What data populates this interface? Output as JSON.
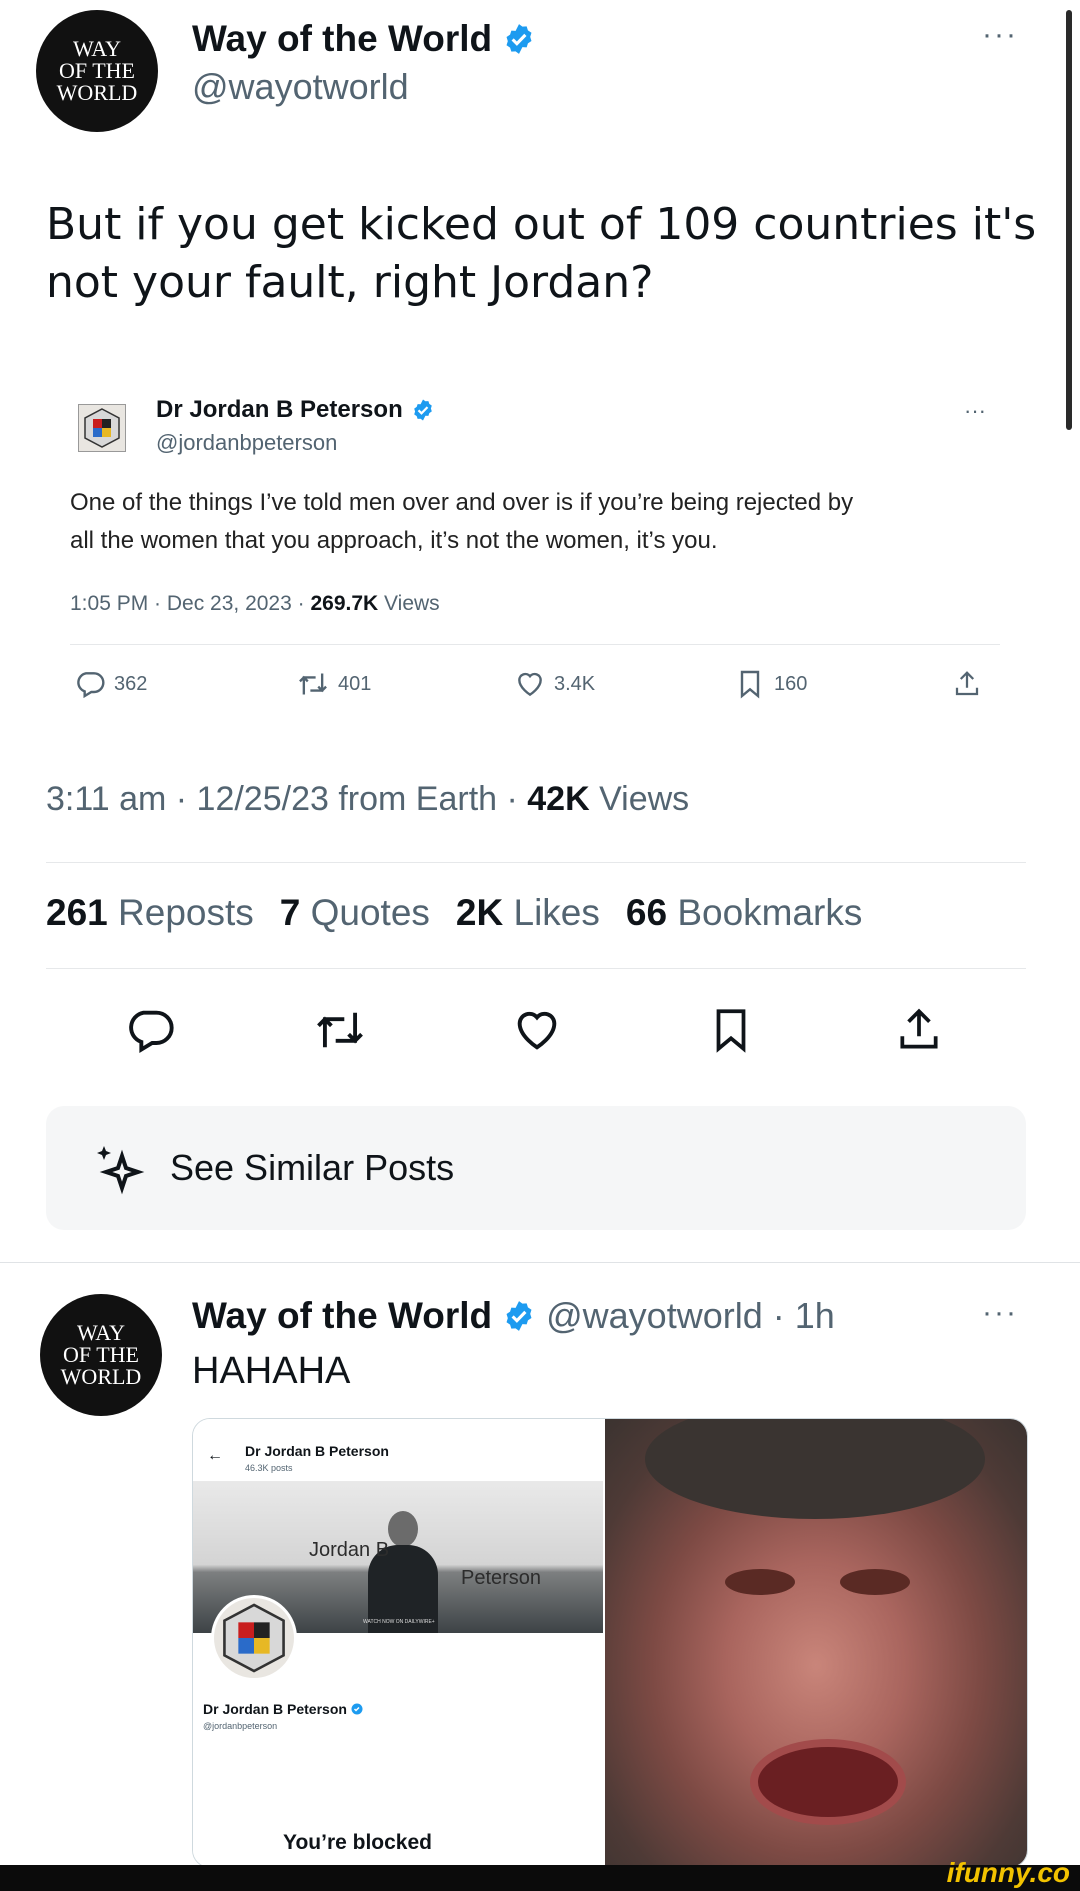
{
  "main_tweet": {
    "avatar_lines": [
      "WAY",
      "OF THE",
      "WORLD"
    ],
    "display_name": "Way of the World",
    "handle": "@wayotworld",
    "more": "···",
    "text_line1": "But if you get kicked out of 109 countries it's",
    "text_line2": "not your fault, right Jordan?",
    "meta_time": "3:11 am · 12/25/23 from Earth · ",
    "meta_views_num": "42K",
    "meta_views_label": " Views",
    "stats": [
      {
        "num": "261",
        "label": "Reposts"
      },
      {
        "num": "7",
        "label": "Quotes"
      },
      {
        "num": "2K",
        "label": "Likes"
      },
      {
        "num": "66",
        "label": "Bookmarks"
      }
    ],
    "similar_label": "See Similar Posts"
  },
  "quoted_tweet": {
    "display_name": "Dr Jordan B Peterson",
    "handle": "@jordanbpeterson",
    "more": "···",
    "text_line1": "One of the things I’ve told men over and over is if you’re being rejected by",
    "text_line2": "all the women that you approach, it’s not the women, it’s you.",
    "meta_time": "1:05 PM · Dec 23, 2023 · ",
    "meta_views_num": "269.7K",
    "meta_views_label": " Views",
    "actions": {
      "replies": "362",
      "reposts": "401",
      "likes": "3.4K",
      "bookmarks": "160"
    }
  },
  "second_tweet": {
    "avatar_lines": [
      "WAY",
      "OF THE",
      "WORLD"
    ],
    "display_name": "Way of the World",
    "handle": "@wayotworld",
    "time": "· 1h",
    "more": "···",
    "text": "HAHAHA",
    "embedded_profile": {
      "name": "Dr Jordan B Peterson",
      "posts": "46.3K posts",
      "banner_text_1": "Jordan B",
      "banner_text_2": "Peterson",
      "banner_small": "WATCH NOW ON DAILYWIRE+",
      "profile_name": "Dr Jordan B Peterson",
      "profile_handle": "@jordanbpeterson",
      "blocked": "You’re blocked"
    }
  },
  "footer": {
    "watermark": "ifunny.co"
  },
  "colors": {
    "accent": "#1d9bf0",
    "muted": "#536471",
    "divider": "#e6e8ea"
  }
}
